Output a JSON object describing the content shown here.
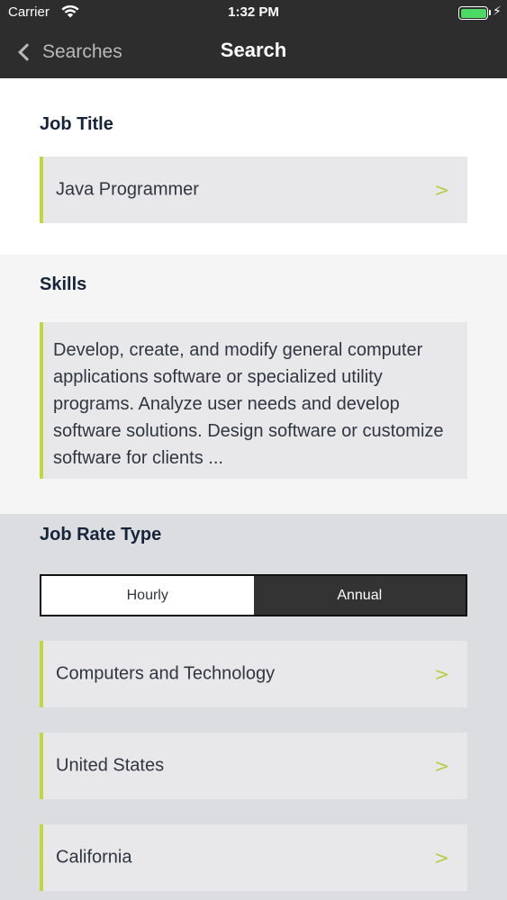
{
  "status_bar": {
    "carrier": "Carrier",
    "time": "1:32 PM",
    "charging_glyph": "⚡",
    "battery_color": "#4cd964"
  },
  "nav": {
    "back_label": "Searches",
    "title": "Search"
  },
  "job_title": {
    "heading": "Job Title",
    "value": "Java Programmer",
    "arrow": ">"
  },
  "skills": {
    "heading": "Skills",
    "text": "Develop, create, and modify general computer applications software or specialized utility programs. Analyze user needs and develop software solutions. Design software or customize software for clients ..."
  },
  "job_rate_type": {
    "heading": "Job Rate Type",
    "options": [
      "Hourly",
      "Annual"
    ],
    "selected": "Annual"
  },
  "filters": [
    {
      "label": "Computers and Technology",
      "arrow": ">"
    },
    {
      "label": "United States",
      "arrow": ">"
    },
    {
      "label": "California",
      "arrow": ">"
    }
  ],
  "colors": {
    "nav_background": "#2d2d2d",
    "accent": "#c2d63e",
    "arrow": "#b6cd3b",
    "heading": "#16243a"
  }
}
